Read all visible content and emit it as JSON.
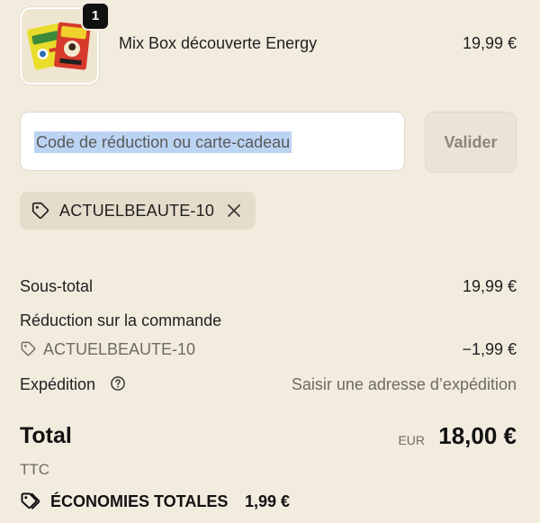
{
  "product": {
    "quantity": "1",
    "name": "Mix Box découverte Energy",
    "price": "19,99 €",
    "image_icon": "product-box-image"
  },
  "discount": {
    "placeholder": "Code de réduction ou carte-cadeau",
    "value": "",
    "apply_label": "Valider",
    "applied_code": "ACTUELBEAUTE-10",
    "remove_icon": "close-icon",
    "tag_icon": "tag-icon"
  },
  "summary": {
    "subtotal_label": "Sous-total",
    "subtotal_value": "19,99 €",
    "order_discount_label": "Réduction sur la commande",
    "order_discount_code": "ACTUELBEAUTE-10",
    "order_discount_value": "−1,99 €",
    "shipping_label": "Expédition",
    "shipping_value": "Saisir une adresse d’expédition",
    "shipping_help_icon": "help-circle-icon"
  },
  "total": {
    "label": "Total",
    "currency": "EUR",
    "value": "18,00 €",
    "tax_note": "TTC",
    "savings_label": "ÉCONOMIES TOTALES",
    "savings_value": "1,99 €",
    "savings_icon": "tags-icon"
  },
  "colors": {
    "background": "#f2ecdf",
    "chip_background": "#e6dccb",
    "selection_highlight": "#bcd4f3",
    "button_disabled_text": "#8b857a"
  }
}
